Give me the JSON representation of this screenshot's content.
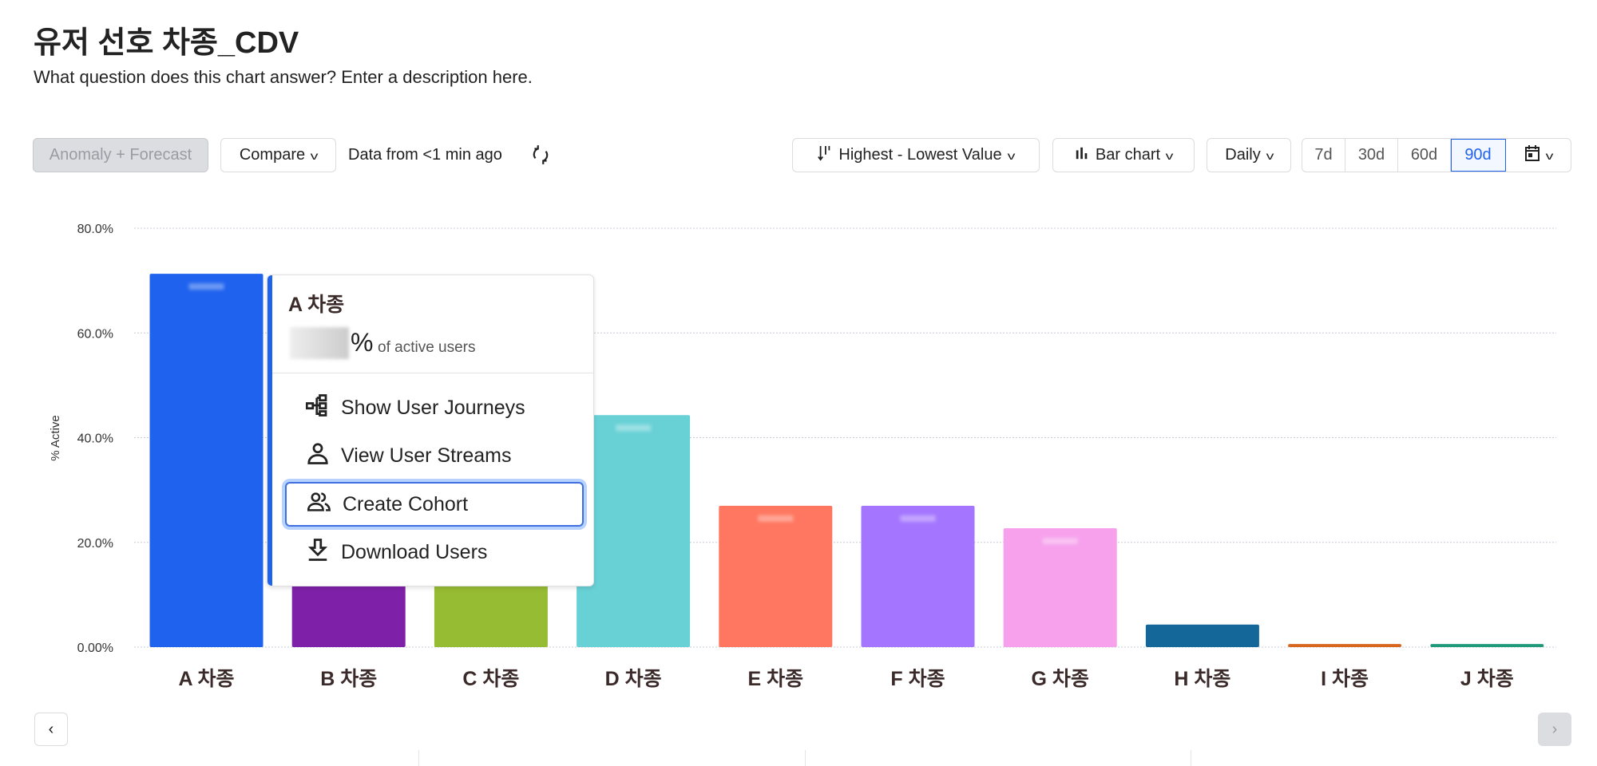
{
  "header": {
    "title": "유저 선호 차종_CDV",
    "description": "What question does this chart answer? Enter a description here."
  },
  "toolbar": {
    "anomaly_label": "Anomaly + Forecast",
    "compare_label": "Compare",
    "data_freshness": "Data from <1 min ago",
    "sort_label": "Highest - Lowest Value",
    "chart_type_label": "Bar chart",
    "interval_label": "Daily",
    "ranges": [
      "7d",
      "30d",
      "60d",
      "90d"
    ],
    "active_range": "90d",
    "icons": {
      "refresh": "refresh-icon",
      "sort": "sort-descending-icon",
      "chart": "bar-chart-icon",
      "calendar": "calendar-icon"
    }
  },
  "tooltip": {
    "title": "A 차종",
    "percent_symbol": "%",
    "subtitle": "of active users",
    "items": [
      {
        "label": "Show User Journeys",
        "icon": "journey-icon"
      },
      {
        "label": "View User Streams",
        "icon": "user-icon"
      },
      {
        "label": "Create Cohort",
        "icon": "users-icon"
      },
      {
        "label": "Download Users",
        "icon": "download-icon"
      }
    ],
    "focused_item": "Create Cohort"
  },
  "chart_data": {
    "type": "bar",
    "ylabel": "% Active",
    "xlabel": "",
    "ylim": [
      0,
      80
    ],
    "yticks": [
      "0.00%",
      "20.0%",
      "40.0%",
      "60.0%",
      "80.0%"
    ],
    "grid": true,
    "categories": [
      "A 차종",
      "B 차종",
      "C 차종",
      "D 차종",
      "E 차종",
      "F 차종",
      "G 차종",
      "H 차종",
      "I 차종",
      "J 차종"
    ],
    "values": [
      71.3,
      60.0,
      50.0,
      44.3,
      27.0,
      27.0,
      22.7,
      4.3,
      0.6,
      0.6
    ],
    "colors": [
      "#1f62ee",
      "#7e21a8",
      "#96bc33",
      "#68d1d6",
      "#ff7760",
      "#a476ff",
      "#f7a1ec",
      "#136899",
      "#d8661c",
      "#1f9a7a"
    ]
  }
}
